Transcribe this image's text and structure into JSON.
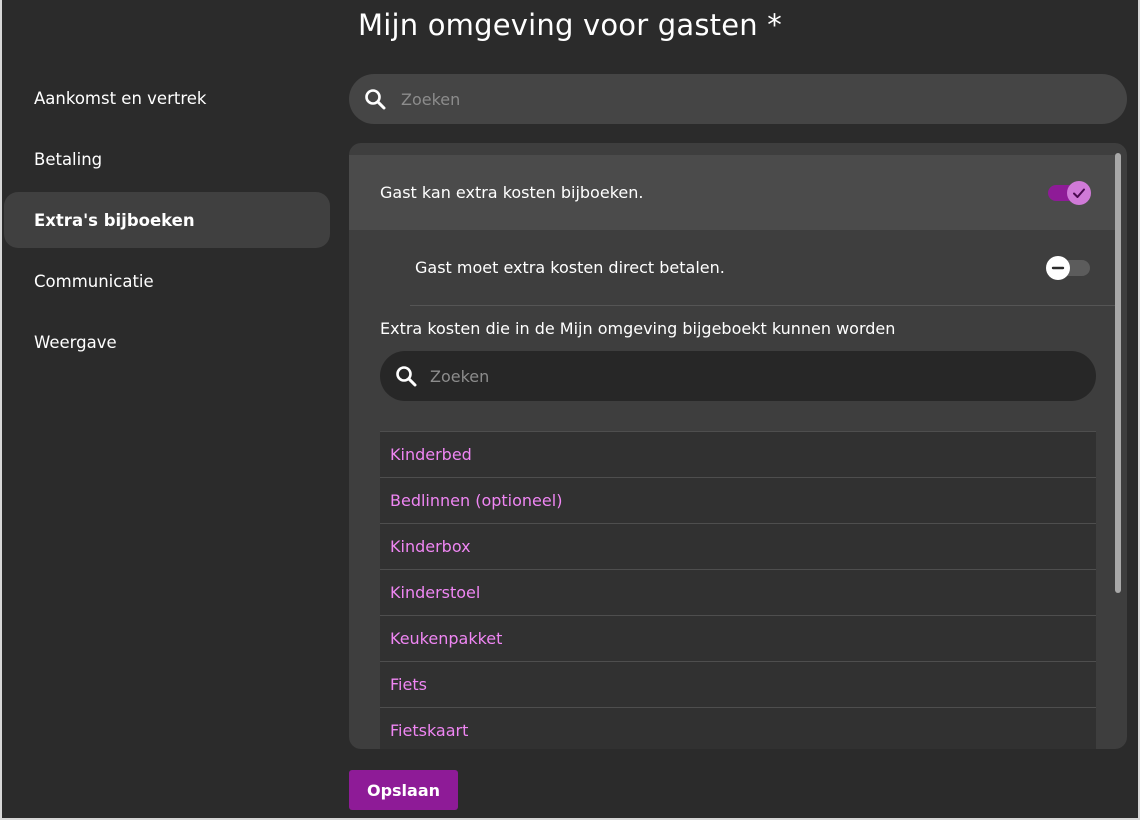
{
  "page": {
    "title": "Mijn omgeving voor gasten *"
  },
  "sidebar": {
    "items": [
      {
        "label": "Aankomst en vertrek"
      },
      {
        "label": "Betaling"
      },
      {
        "label": "Extra's bijboeken",
        "active": true
      },
      {
        "label": "Communicatie"
      },
      {
        "label": "Weergave"
      }
    ]
  },
  "search": {
    "placeholder": "Zoeken",
    "icon": "search-icon"
  },
  "settings": {
    "guest_can_book_extras": {
      "label": "Gast kan extra kosten bijboeken.",
      "enabled": true
    },
    "guest_must_pay_directly": {
      "label": "Gast moet extra kosten direct betalen.",
      "enabled": false
    }
  },
  "extras": {
    "label": "Extra kosten die in de Mijn omgeving bijgeboekt kunnen worden",
    "search_placeholder": "Zoeken",
    "items": [
      {
        "label": "Kinderbed"
      },
      {
        "label": "Bedlinnen (optioneel)"
      },
      {
        "label": "Kinderbox"
      },
      {
        "label": "Kinderstoel"
      },
      {
        "label": "Keukenpakket"
      },
      {
        "label": "Fiets"
      },
      {
        "label": "Fietskaart"
      }
    ]
  },
  "footer": {
    "save_label": "Opslaan"
  },
  "colors": {
    "background": "#2b2b2b",
    "accent": "#8e1b97",
    "link": "#ef86f3",
    "panel": "#3e3e3e"
  }
}
